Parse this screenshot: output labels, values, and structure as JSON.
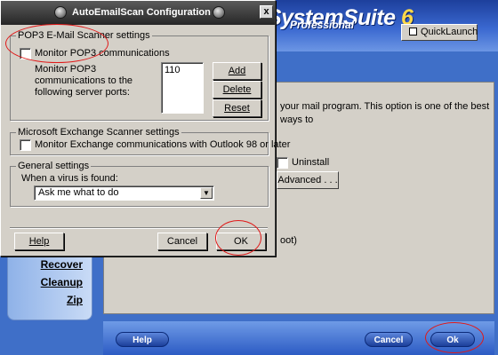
{
  "app": {
    "logo": "SystemSuite",
    "logo_num": "6",
    "logo_sub": "Professional",
    "quicklaunch": "QuickLaunch",
    "sidebar": [
      "Recover",
      "Cleanup",
      "Zip"
    ],
    "description": "your mail program.  This option is one of the best ways to",
    "uninstall_label": "Uninstall",
    "advanced_label": "Advanced . . .",
    "pot_text": "oot)",
    "footer": {
      "help": "Help",
      "cancel": "Cancel",
      "ok": "Ok"
    }
  },
  "dialog": {
    "title": "AutoEmailScan Configuration",
    "close": "x",
    "pop3": {
      "group_title": "POP3 E-Mail Scanner settings",
      "monitor_label": "Monitor POP3 communications",
      "monitor_checked": false,
      "ports_label": "Monitor POP3 communications to the following server ports:",
      "ports": [
        "110"
      ],
      "add": "Add",
      "delete": "Delete",
      "reset": "Reset"
    },
    "exchange": {
      "group_title": "Microsoft Exchange Scanner settings",
      "monitor_label": "Monitor Exchange communications with Outlook 98 or later",
      "monitor_checked": false
    },
    "general": {
      "group_title": "General settings",
      "virus_label": "When a virus is found:",
      "virus_action": "Ask me what to do"
    },
    "buttons": {
      "help": "Help",
      "cancel": "Cancel",
      "ok": "OK"
    }
  },
  "colors": {
    "annotation": "#e01818",
    "title_bar": "#262626"
  }
}
